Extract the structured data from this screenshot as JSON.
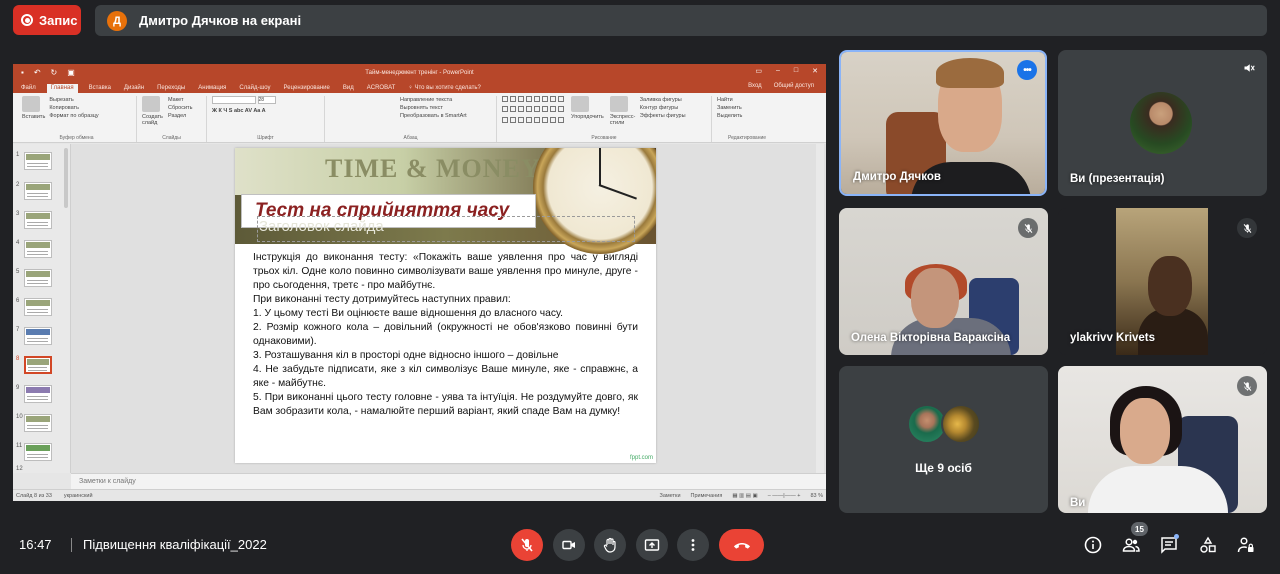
{
  "top": {
    "record_label": "Запис",
    "presenter_initial": "Д",
    "presenter_text": "Дмитро Дячков на екрані"
  },
  "ppt": {
    "window_title": "Тайм-менеджмент тренінг - PowerPoint",
    "tabs": [
      "Файл",
      "Главная",
      "Вставка",
      "Дизайн",
      "Переходы",
      "Анимация",
      "Слайд-шоу",
      "Рецензирование",
      "Вид",
      "ACROBAT"
    ],
    "tell_me": "♀ Что вы хотите сделать?",
    "sign_in": "Вход",
    "share": "Общий доступ",
    "ribbon": {
      "paste": "Вставить",
      "cut": "Вырезать",
      "copy": "Копировать",
      "format_painter": "Формат по образцу",
      "clipboard": "Буфер обмена",
      "new_slide": "Создать слайд",
      "layout": "Макет",
      "reset": "Сбросить",
      "section": "Раздел",
      "slides": "Слайды",
      "font_size": "28",
      "font": "Шрифт",
      "text_direction": "Направление текста",
      "align_text": "Выровнять текст",
      "smartart": "Преобразовать в SmartArt",
      "paragraph": "Абзац",
      "arrange": "Упорядочить",
      "quick_styles": "Экспресс-стили",
      "shape_fill": "Заливка фигуры",
      "shape_outline": "Контур фигуры",
      "shape_effects": "Эффекты фигуры",
      "drawing": "Рисование",
      "find": "Найти",
      "replace": "Заменить",
      "select": "Выделить",
      "editing": "Редактирование"
    },
    "slide_numbers": [
      "1",
      "2",
      "3",
      "4",
      "5",
      "6",
      "7",
      "8",
      "9",
      "10",
      "11",
      "12"
    ],
    "active_slide": "8",
    "slide": {
      "banner_text": "TIME & MONEY",
      "title": "Тест на сприйняття часу",
      "placeholder": "Заголовок слайда",
      "body": [
        "Інструкція до виконання тесту: «Покажіть ваше уявлення про час у вигляді трьох кіл. Одне коло повинно символізувати ваше уявлення про минуле, друге - про сьогодення, третє - про майбутнє.",
        "При виконанні тесту дотримуйтесь наступних правил:",
        "1. У цьому тесті Ви оцінюєте ваше відношення до власного  часу.",
        "2. Розмір кожного кола – довільний (окружності не обов'язково повинні бути однаковими).",
        "3. Розташування кіл в просторі одне відносно іншого – довільне",
        "4. Не забудьте підписати, яке з кіл символізує Ваше минуле, яке - справжнє, а яке - майбутнє.",
        "5. При виконанні цього тесту головне - уява та інтуїція. Не роздумуйте довго, як Вам зобразити кола, - намалюйте перший варіант, який спаде Вам на думку!"
      ],
      "footer": "fppt.com"
    },
    "notes_placeholder": "Заметки к слайду",
    "status": {
      "slide_count": "Слайд 8 из 33",
      "language": "украинский",
      "notes": "Заметки",
      "comments": "Примечания",
      "zoom": "83 %"
    }
  },
  "participants": [
    {
      "name": "Дмитро Дячков"
    },
    {
      "name": "Ви (презентація)"
    },
    {
      "name": "Олена Вікторівна Вараксіна"
    },
    {
      "name": "ylakrivv Krivets"
    },
    {
      "name": "Ще 9 осіб"
    },
    {
      "name": "Ви"
    }
  ],
  "bottom": {
    "time": "16:47",
    "meeting_name": "Підвищення кваліфікації_2022",
    "people_count": "15"
  },
  "colors": {
    "background": "#202124",
    "tile": "#3c4043",
    "red": "#ea4335",
    "record_red": "#d93025",
    "ppt_accent": "#b7472a",
    "active_border": "#8ab4f8"
  }
}
